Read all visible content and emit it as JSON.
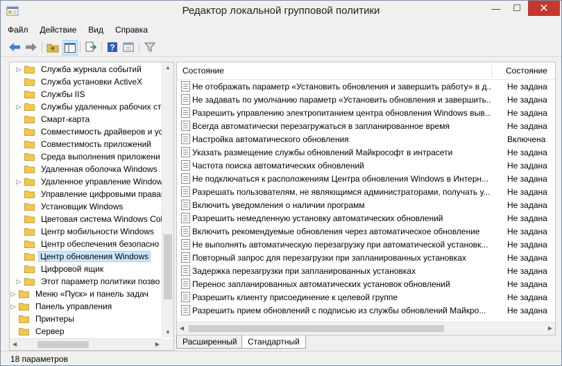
{
  "window": {
    "title": "Редактор локальной групповой политики",
    "minimize": "—",
    "maximize": "☐",
    "close": "✕"
  },
  "menu": [
    "Файл",
    "Действие",
    "Вид",
    "Справка"
  ],
  "toolbar": [
    "back-icon",
    "forward-icon",
    "up-folder-icon",
    "show-hide-tree-icon",
    "export-list-icon",
    "help-icon",
    "properties-icon",
    "filter-icon"
  ],
  "tree": {
    "items": [
      {
        "label": "Служба журнала событий",
        "expandable": true,
        "selected": false
      },
      {
        "label": "Служба установки ActiveX",
        "expandable": false,
        "selected": false
      },
      {
        "label": "Службы IIS",
        "expandable": false,
        "selected": false
      },
      {
        "label": "Службы удаленных рабочих сто",
        "expandable": true,
        "selected": false
      },
      {
        "label": "Смарт-карта",
        "expandable": false,
        "selected": false
      },
      {
        "label": "Совместимость драйверов и уст",
        "expandable": false,
        "selected": false
      },
      {
        "label": "Совместимость приложений",
        "expandable": false,
        "selected": false
      },
      {
        "label": "Среда выполнения приложени",
        "expandable": false,
        "selected": false
      },
      {
        "label": "Удаленная оболочка Windows",
        "expandable": false,
        "selected": false
      },
      {
        "label": "Удаленное управление Window",
        "expandable": true,
        "selected": false
      },
      {
        "label": "Управление цифровыми правам",
        "expandable": false,
        "selected": false
      },
      {
        "label": "Установщик Windows",
        "expandable": false,
        "selected": false
      },
      {
        "label": "Цветовая система Windows Colo",
        "expandable": false,
        "selected": false
      },
      {
        "label": "Центр мобильности Windows",
        "expandable": false,
        "selected": false
      },
      {
        "label": "Центр обеспечения безопасно",
        "expandable": false,
        "selected": false
      },
      {
        "label": "Центр обновления Windows",
        "expandable": false,
        "selected": true
      },
      {
        "label": "Цифровой ящик",
        "expandable": false,
        "selected": false
      },
      {
        "label": "Этот параметр политики позво",
        "expandable": true,
        "selected": false
      }
    ],
    "root_items": [
      {
        "label": "Меню «Пуск» и панель задач",
        "expandable": true
      },
      {
        "label": "Панель управления",
        "expandable": true
      },
      {
        "label": "Принтеры",
        "expandable": false
      },
      {
        "label": "Сервер",
        "expandable": false
      }
    ]
  },
  "list": {
    "col_name": "Состояние",
    "col_state": "Состояние",
    "rows": [
      {
        "name": "Не отображать параметр «Установить обновления и завершить работу» в д...",
        "state": "Не задана"
      },
      {
        "name": "Не задавать по умолчанию параметр «Установить обновления и завершить...",
        "state": "Не задана"
      },
      {
        "name": "Разрешить управлению электропитанием центра обновления Windows выв...",
        "state": "Не задана"
      },
      {
        "name": "Всегда автоматически перезагружаться в запланированное время",
        "state": "Не задана"
      },
      {
        "name": "Настройка автоматического обновления",
        "state": "Включена"
      },
      {
        "name": "Указать размещение службы обновлений Майкрософт в интрасети",
        "state": "Не задана"
      },
      {
        "name": "Частота поиска автоматических обновлений",
        "state": "Не задана"
      },
      {
        "name": "Не подключаться к расположениям Центра обновления Windows в Интерн...",
        "state": "Не задана"
      },
      {
        "name": "Разрешать пользователям, не являющимся администраторами, получать у...",
        "state": "Не задана"
      },
      {
        "name": "Включить уведомления о наличии программ",
        "state": "Не задана"
      },
      {
        "name": "Разрешить немедленную установку автоматических обновлений",
        "state": "Не задана"
      },
      {
        "name": "Включить рекомендуемые обновления через автоматическое обновление",
        "state": "Не задана"
      },
      {
        "name": "Не выполнять автоматическую перезагрузку при автоматической установк...",
        "state": "Не задана"
      },
      {
        "name": "Повторный запрос для перезагрузки при запланированных установках",
        "state": "Не задана"
      },
      {
        "name": "Задержка перезагрузки при запланированных установках",
        "state": "Не задана"
      },
      {
        "name": "Перенос запланированных автоматических установок обновлений",
        "state": "Не задана"
      },
      {
        "name": "Разрешить клиенту присоединение к целевой группе",
        "state": "Не задана"
      },
      {
        "name": "Разрешить прием обновлений с подписью из службы обновлений Майкро...",
        "state": "Не задана"
      }
    ]
  },
  "tabs": {
    "extended": "Расширенный",
    "standard": "Стандартный"
  },
  "status": "18 параметров",
  "colors": {
    "selection": "#cce8ff",
    "close": "#c7372f",
    "folder": "#f2c94c"
  }
}
